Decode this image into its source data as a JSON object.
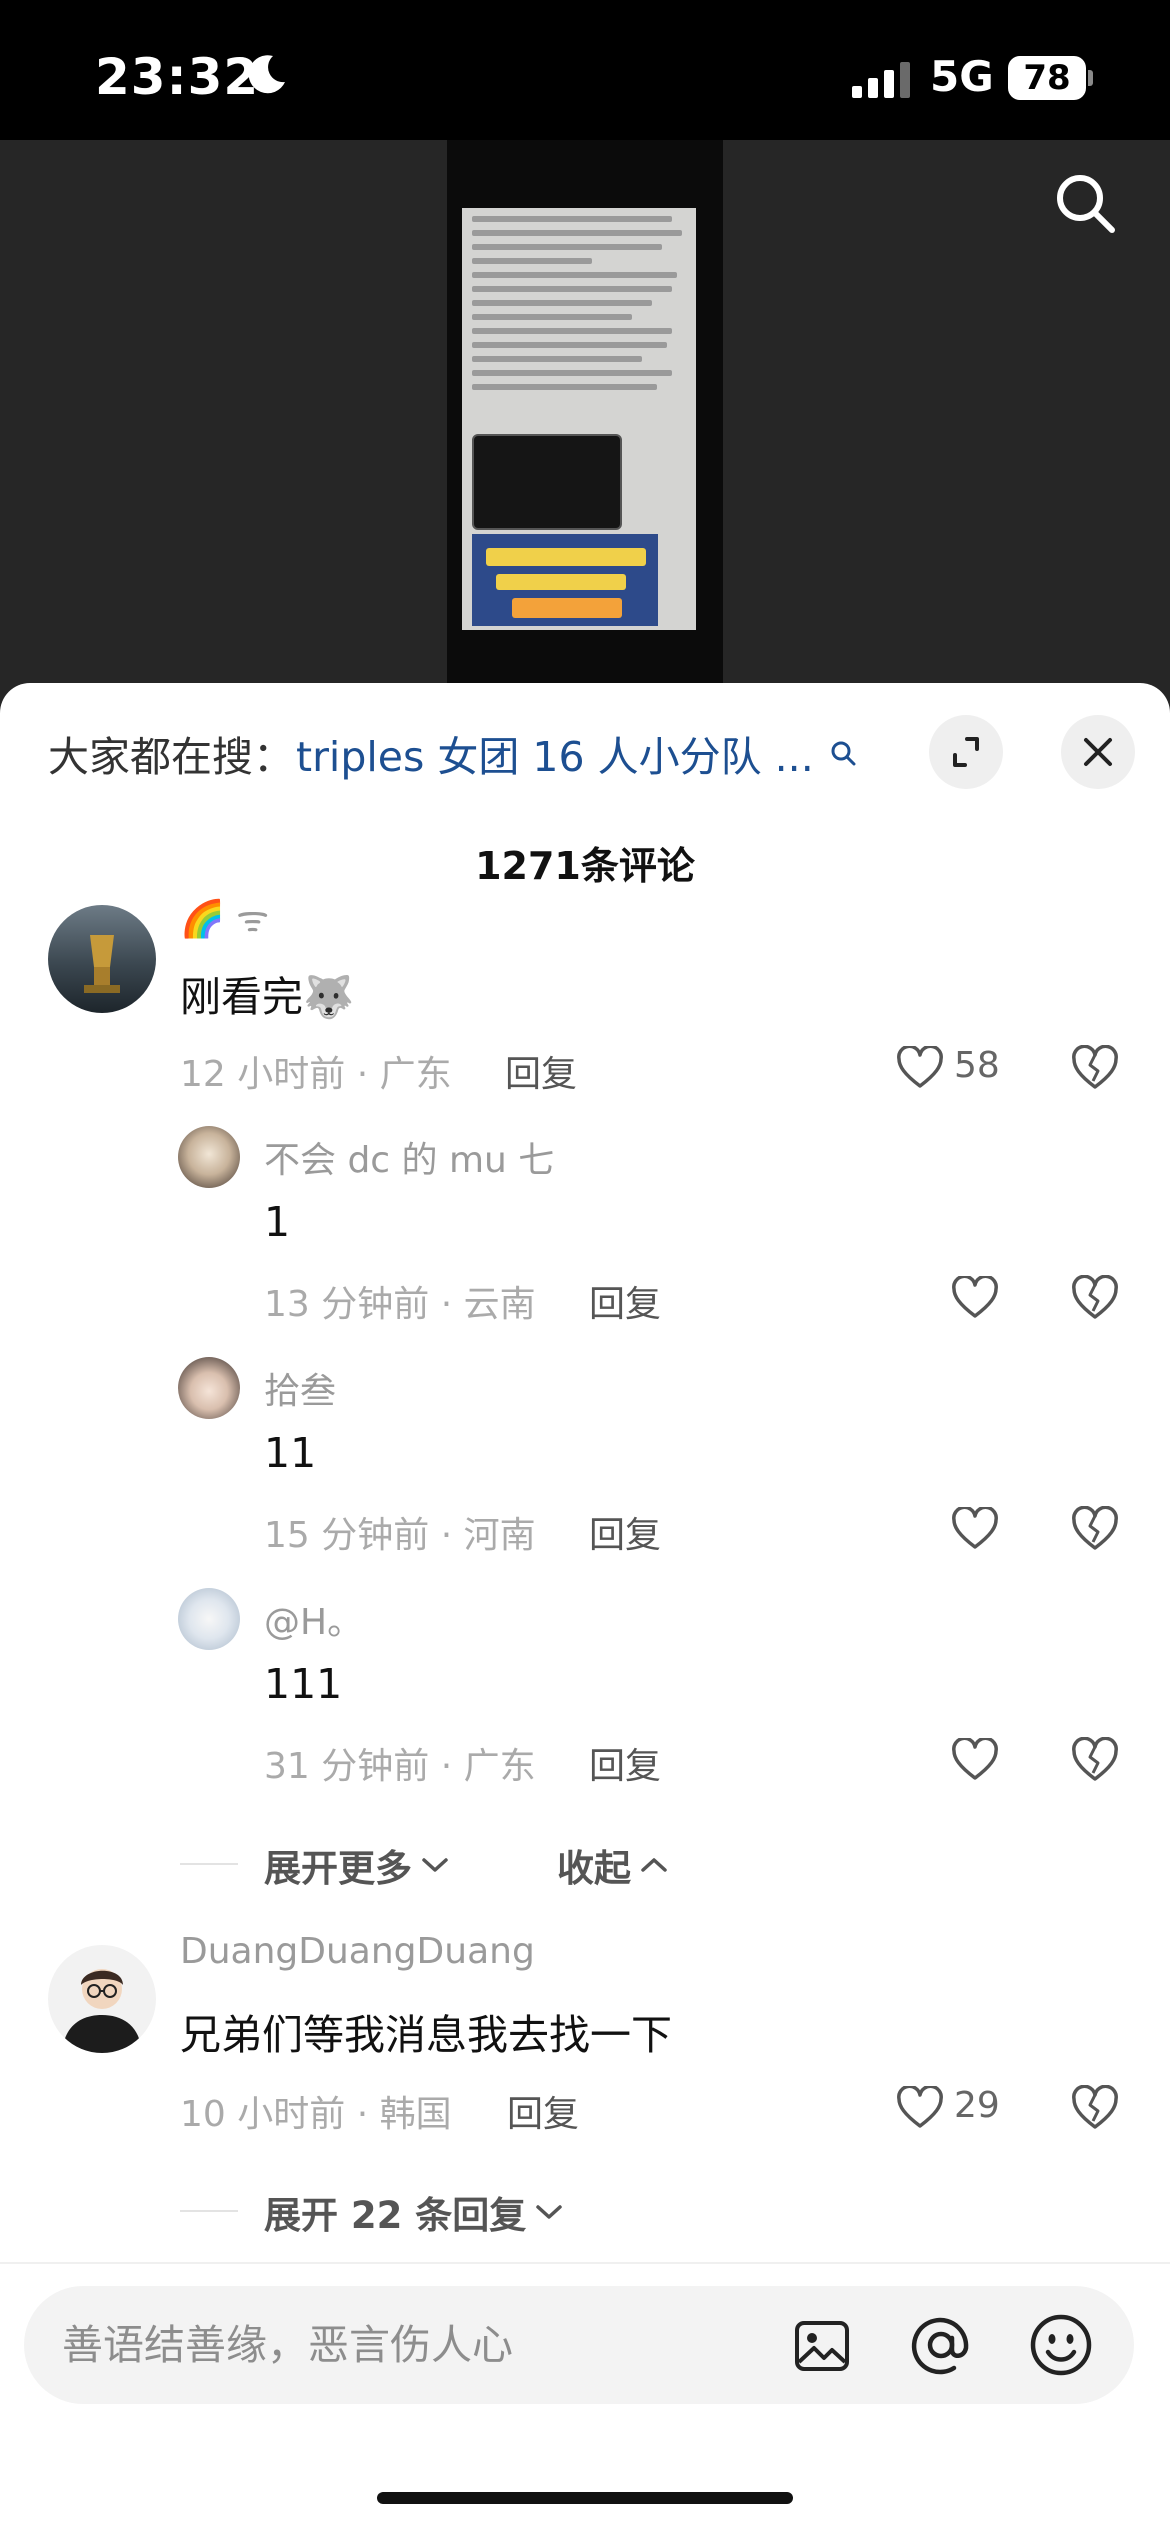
{
  "status_bar": {
    "time": "23:32",
    "network": "5G",
    "battery": "78"
  },
  "video": {
    "search_icon": "search-icon"
  },
  "header": {
    "hot_search_prefix": "大家都在搜：",
    "hot_search_term": "triples 女团 16 人小分队 ...",
    "expand_icon": "expand-icon",
    "close_icon": "close-icon"
  },
  "comment_count": "1271条评论",
  "comments": [
    {
      "username": "🌈 ᯤ",
      "text": "刚看完🐺",
      "time_location": "12 小时前 · 广东",
      "reply_label": "回复",
      "likes": "58",
      "replies": [
        {
          "username": "不会 dc 的 mu 七",
          "text": "1",
          "time_location": "13 分钟前 · 云南",
          "reply_label": "回复"
        },
        {
          "username": "拾叁",
          "text": "11",
          "time_location": "15 分钟前 · 河南",
          "reply_label": "回复"
        },
        {
          "username": "@H。",
          "text": "111",
          "time_location": "31 分钟前 · 广东",
          "reply_label": "回复"
        }
      ],
      "expand_more": "展开更多",
      "collapse": "收起"
    },
    {
      "username": "DuangDuangDuang",
      "text": "兄弟们等我消息我去找一下",
      "time_location": "10 小时前 · 韩国",
      "reply_label": "回复",
      "likes": "29",
      "expand_replies": "展开 22 条回复"
    }
  ],
  "input": {
    "placeholder": "善语结善缘，恶言伤人心",
    "icons": [
      "image-icon",
      "at-icon",
      "emoji-icon"
    ]
  },
  "colors": {
    "accent_link": "#1d4f91",
    "status_bar_bg": "#000000",
    "video_bg": "#262626"
  }
}
